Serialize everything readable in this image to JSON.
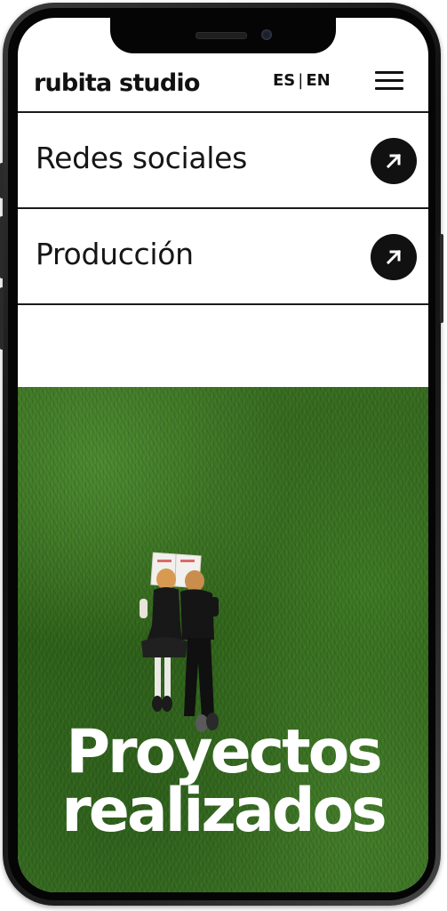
{
  "header": {
    "brand": "rubita studio",
    "lang_es": "ES",
    "lang_separator": "|",
    "lang_en": "EN",
    "menu_icon": "hamburger-menu-icon"
  },
  "services": [
    {
      "label": "Redes sociales",
      "icon": "arrow-up-right-icon"
    },
    {
      "label": "Producción",
      "icon": "arrow-up-right-icon"
    }
  ],
  "hero": {
    "title_line1": "Proyectos",
    "title_line2": "realizados"
  },
  "colors": {
    "text": "#111111",
    "background": "#ffffff",
    "button": "#111111",
    "hero_title": "#ffffff",
    "grass": "#386c22"
  }
}
